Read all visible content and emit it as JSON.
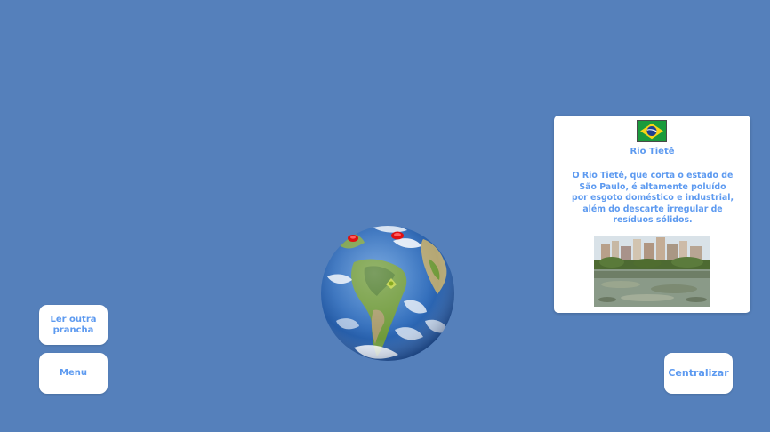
{
  "buttons": {
    "ler_outra_prancha": "Ler outra prancha",
    "menu": "Menu",
    "centralizar": "Centralizar"
  },
  "info_card": {
    "title": "Rio Tietê",
    "description": "O Rio Tietê, que corta o estado de São Paulo, é altamente poluído por esgoto doméstico e industrial, além do descarte irregular de resíduos sólidos.",
    "flag_icon": "brazil-flag-icon",
    "image_icon": "polluted-river-photo"
  },
  "colors": {
    "background": "#5580bb",
    "accent_text": "#5d9af0",
    "panel": "#ffffff",
    "marker": "#e01010"
  }
}
